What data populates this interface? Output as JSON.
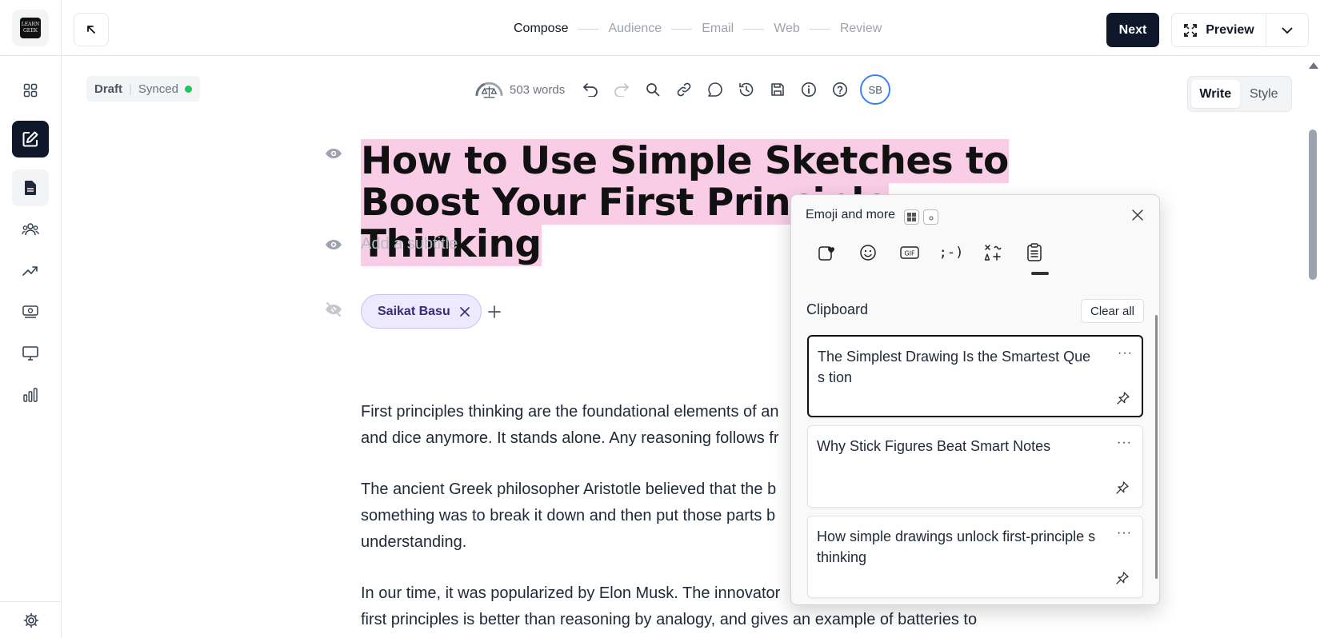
{
  "app": {
    "logo_text": "LEARN GEEK"
  },
  "steps": [
    {
      "label": "Compose",
      "active": true
    },
    {
      "label": "Audience",
      "active": false
    },
    {
      "label": "Email",
      "active": false
    },
    {
      "label": "Web",
      "active": false
    },
    {
      "label": "Review",
      "active": false
    }
  ],
  "header": {
    "next_label": "Next",
    "preview_label": "Preview"
  },
  "status": {
    "draft": "Draft",
    "synced": "Synced"
  },
  "toolbar": {
    "word_count": "503 words",
    "avatar_initials": "SB"
  },
  "mode": {
    "write": "Write",
    "style": "Style"
  },
  "post": {
    "title": "How to Use Simple Sketches to Boost Your First Principle Thinking",
    "subtitle_placeholder": "Add a subtitle",
    "author": "Saikat Basu",
    "paragraphs": [
      "First principles thinking are the foundational elements of an",
      "and dice anymore. It stands alone. Any reasoning follows fr",
      "The ancient Greek philosopher Aristotle believed that the b",
      "something was to break it down and then put those parts b",
      "understanding.",
      "In our time, it was popularized by Elon Musk. The innovator",
      "first principles is better than reasoning by analogy, and gives an example of batteries to"
    ]
  },
  "emoji_panel": {
    "title": "Emoji and more",
    "tabs": [
      "favorites",
      "emoji",
      "gif",
      "kaomoji",
      "symbols",
      "clipboard"
    ],
    "active_tab": "clipboard",
    "gif_label": "GIF",
    "kaomoji_label": ";-)",
    "section_title": "Clipboard",
    "clear_all": "Clear all",
    "items": [
      {
        "text": "The Simplest Drawing Is the Smartest Ques tion",
        "selected": true
      },
      {
        "text": "Why Stick Figures Beat Smart Notes",
        "selected": false
      },
      {
        "text": "How simple drawings unlock first-principle s thinking",
        "selected": false
      }
    ],
    "more_label": "···"
  }
}
